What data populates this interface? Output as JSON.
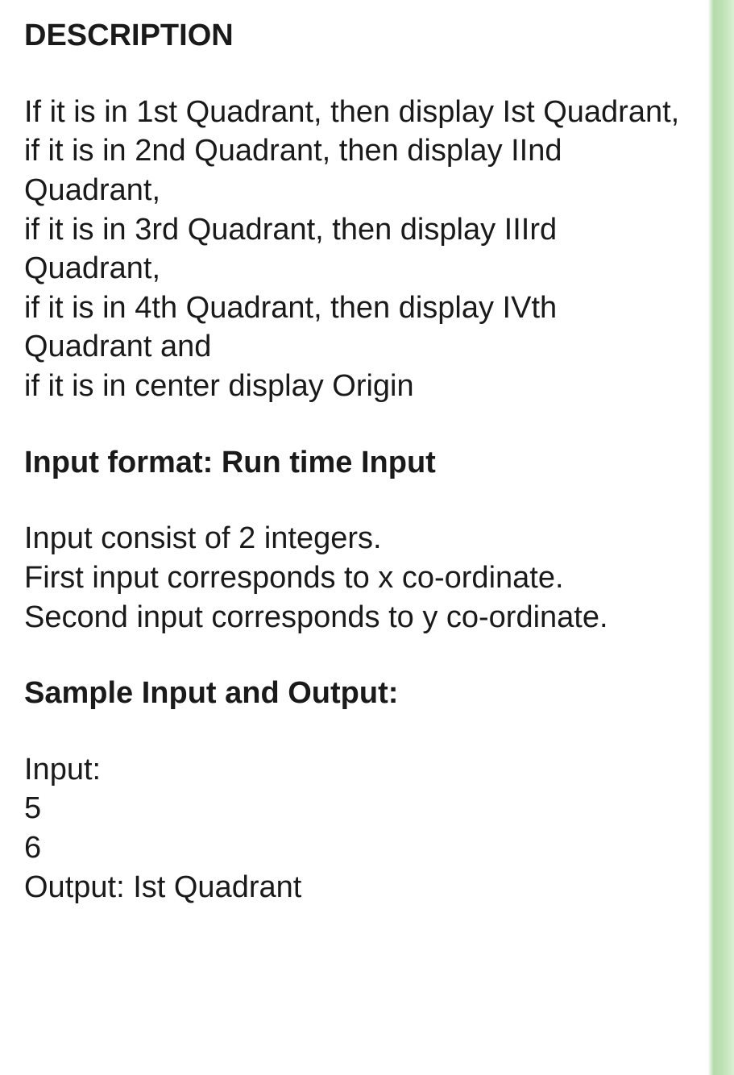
{
  "heading": "DESCRIPTION",
  "rules": {
    "line1": "If it is in 1st Quadrant, then display Ist Quadrant,",
    "line2": "if it is in 2nd Quadrant, then display IInd Quadrant,",
    "line3": "if it is in 3rd Quadrant, then display IIIrd Quadrant,",
    "line4": "if it is in 4th Quadrant, then display IVth Quadrant and",
    "line5": "if it is in center display Origin"
  },
  "input_format_heading": "Input format: Run time Input",
  "input_details": {
    "line1": "Input consist of 2 integers.",
    "line2": "First input corresponds to x co-ordinate.",
    "line3": "Second input corresponds to y co-ordinate."
  },
  "sample_heading": "Sample Input and Output:",
  "sample": {
    "input_label": "Input:",
    "input_x": "5",
    "input_y": "6",
    "output_line": "Output: Ist Quadrant"
  }
}
